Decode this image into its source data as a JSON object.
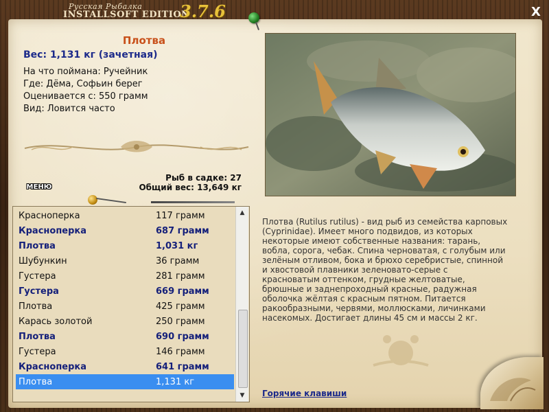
{
  "window": {
    "brand_small": "Русская Рыбалка",
    "brand_big": "INSTALLSOFT EDITION",
    "version": "3.7.6",
    "close_label": "X"
  },
  "fish": {
    "name": "Плотва",
    "weight": "Вес: 1,131 кг (зачетная)",
    "caught_on": "На что поймана: Ручейник",
    "location": "Где: Дёма, Софьин берег",
    "valued_from": "Оценивается с: 550 грамм",
    "kind": "Вид: Ловится часто"
  },
  "stats": {
    "count": "Рыб в садке: 27",
    "total": "Общий вес: 13,649 кг"
  },
  "menu_label": "МЕНЮ",
  "catch_list": [
    {
      "name": "Красноперка",
      "weight": "117 грамм",
      "bold": false
    },
    {
      "name": "Красноперка",
      "weight": "687 грамм",
      "bold": true
    },
    {
      "name": "Плотва",
      "weight": "1,031 кг",
      "bold": true
    },
    {
      "name": "Шубункин",
      "weight": "36 грамм",
      "bold": false
    },
    {
      "name": "Густера",
      "weight": "281 грамм",
      "bold": false
    },
    {
      "name": "Густера",
      "weight": "669 грамм",
      "bold": true
    },
    {
      "name": "Плотва",
      "weight": "425 грамм",
      "bold": false
    },
    {
      "name": "Карась золотой",
      "weight": "250 грамм",
      "bold": false
    },
    {
      "name": "Плотва",
      "weight": "690 грамм",
      "bold": true
    },
    {
      "name": "Густера",
      "weight": "146 грамм",
      "bold": false
    },
    {
      "name": "Красноперка",
      "weight": "641 грамм",
      "bold": true
    },
    {
      "name": "Плотва",
      "weight": "1,131 кг",
      "bold": false,
      "selected": true
    }
  ],
  "description": "Плотва (Rutilus rutilus) - вид рыб из семейства карповых (Cyprinidae). Имеет много подвидов, из которых некоторые имеют собственные названия: тарань, вобла, сорога, чебак. Спина черноватая, с голубым или зелёным отливом, бока и брюхо серебристые, спинной и хвостовой плавники зеленовато-серые с красноватым оттенком, грудные желтоватые, брюшные и заднепроходный красные, радужная оболочка жёлтая с красным пятном. Питается ракообразными, червями, моллюсками, личинками насекомых. Достигает длины 45 см и массы 2 кг.",
  "hotkeys_label": "Горячие клавиши",
  "colors": {
    "fish_name": "#c8501a",
    "bold_text": "#15207a",
    "selection": "#3a8ef0",
    "version": "#e8c13a"
  }
}
